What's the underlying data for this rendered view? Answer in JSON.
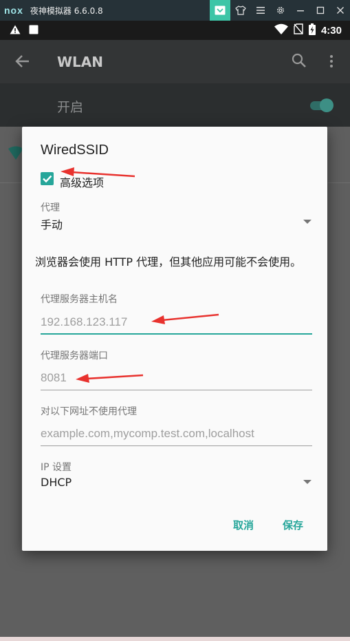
{
  "emulator": {
    "logo": "nox",
    "title": "夜神模拟器 6.6.0.8",
    "tool_icons": [
      "notification-icon",
      "shirt-icon",
      "menu-icon",
      "gear-icon",
      "minimize-icon",
      "maximize-icon",
      "close-icon"
    ]
  },
  "status_bar": {
    "time": "4:30",
    "icons": [
      "warning-icon",
      "square-icon",
      "wifi-icon",
      "no-sim-icon",
      "battery-charging-icon"
    ]
  },
  "app_bar": {
    "title": "WLAN"
  },
  "wlan_switch": {
    "label": "开启",
    "state": "on"
  },
  "dialog": {
    "title": "WiredSSID",
    "advanced_checkbox": {
      "label": "高级选项",
      "checked": true
    },
    "proxy": {
      "label": "代理",
      "value": "手动"
    },
    "note": "浏览器会使用 HTTP 代理，但其他应用可能不会使用。",
    "proxy_host": {
      "label": "代理服务器主机名",
      "placeholder": "192.168.123.117"
    },
    "proxy_port": {
      "label": "代理服务器端口",
      "placeholder": "8081"
    },
    "bypass": {
      "label": "对以下网址不使用代理",
      "placeholder": "example.com,mycomp.test.com,localhost"
    },
    "ip_settings": {
      "label": "IP 设置",
      "value": "DHCP"
    },
    "buttons": {
      "cancel": "取消",
      "save": "保存"
    }
  },
  "colors": {
    "accent": "#26a69a",
    "annotation": "#e8322e",
    "emulator_bar": "#263238",
    "emulator_active_tool": "#3dc5a7"
  }
}
